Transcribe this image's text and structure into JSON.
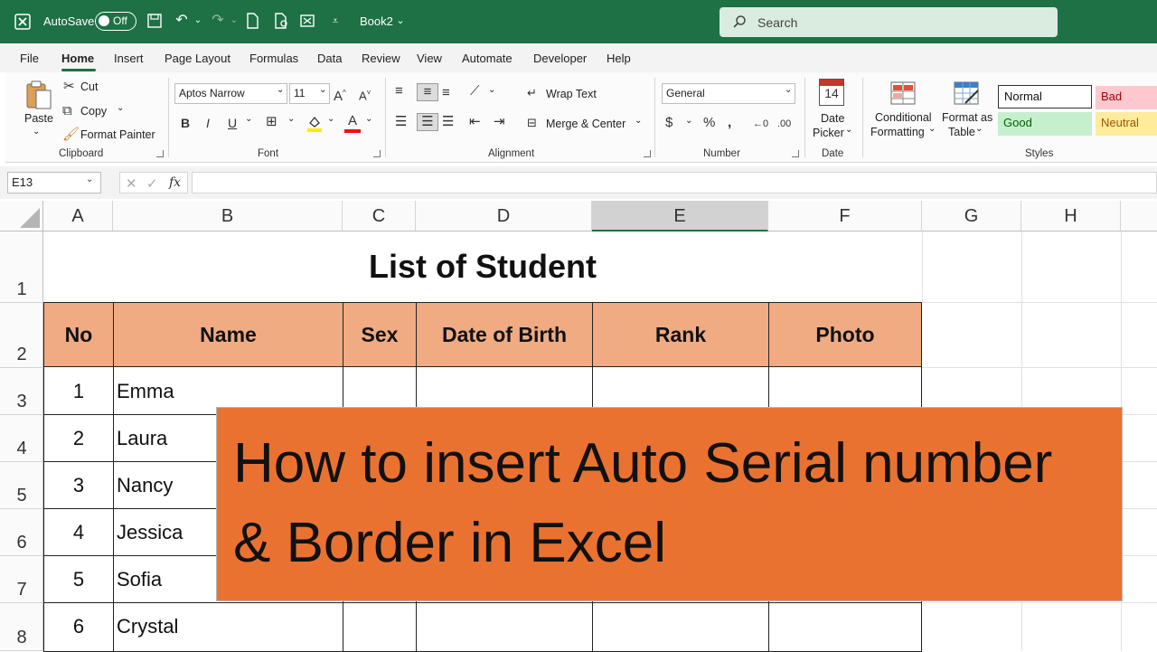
{
  "titlebar": {
    "autosave_label": "AutoSave",
    "autosave_state": "Off",
    "book_name": "Book2",
    "search_placeholder": "Search"
  },
  "menu": {
    "tabs": [
      "File",
      "Home",
      "Insert",
      "Page Layout",
      "Formulas",
      "Data",
      "Review",
      "View",
      "Automate",
      "Developer",
      "Help"
    ],
    "active": "Home"
  },
  "ribbon": {
    "clipboard": {
      "paste": "Paste",
      "cut": "Cut",
      "copy": "Copy",
      "format_painter": "Format Painter",
      "group": "Clipboard"
    },
    "font": {
      "name": "Aptos Narrow",
      "size": "11",
      "group": "Font"
    },
    "alignment": {
      "wrap_text": "Wrap Text",
      "merge_center": "Merge & Center",
      "group": "Alignment"
    },
    "number": {
      "format": "General",
      "group": "Number"
    },
    "date": {
      "day": "14",
      "label1": "Date",
      "label2": "Picker",
      "group": "Date"
    },
    "styles": {
      "conditional1": "Conditional",
      "conditional2": "Formatting",
      "format_as1": "Format as",
      "format_as2": "Table",
      "normal": "Normal",
      "bad": "Bad",
      "good": "Good",
      "neutral": "Neutral",
      "group": "Styles"
    }
  },
  "formula_bar": {
    "name_box": "E13",
    "fx": "fx",
    "value": ""
  },
  "grid": {
    "columns": [
      "A",
      "B",
      "C",
      "D",
      "E",
      "F",
      "G",
      "H"
    ],
    "selected_column": "E",
    "rows": [
      "1",
      "2",
      "3",
      "4",
      "5",
      "6",
      "7",
      "8"
    ],
    "title": "List of Student",
    "headers": [
      "No",
      "Name",
      "Sex",
      "Date of Birth",
      "Rank",
      "Photo"
    ],
    "students": [
      {
        "no": "1",
        "name": "Emma"
      },
      {
        "no": "2",
        "name": "Laura"
      },
      {
        "no": "3",
        "name": "Nancy"
      },
      {
        "no": "4",
        "name": "Jessica"
      },
      {
        "no": "5",
        "name": "Sofia"
      },
      {
        "no": "6",
        "name": "Crystal"
      }
    ]
  },
  "overlay": {
    "line1": "How to insert Auto Serial number",
    "line2": "& Border in Excel",
    "color": "#ea7230"
  },
  "colors": {
    "excel_green": "#1e7145",
    "header_fill": "#f0ab82"
  }
}
